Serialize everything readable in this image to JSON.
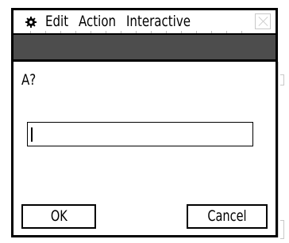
{
  "menubar": {
    "items": [
      {
        "label": "Edit"
      },
      {
        "label": "Action"
      },
      {
        "label": "Interactive"
      }
    ],
    "icons": {
      "settings": "gear-icon",
      "close": "close-icon"
    }
  },
  "dialog": {
    "prompt": "A?",
    "input_value": "",
    "ok_label": "OK",
    "cancel_label": "Cancel"
  },
  "colors": {
    "toolbar": "#4d4d4d",
    "border": "#000000",
    "background": "#ffffff"
  }
}
